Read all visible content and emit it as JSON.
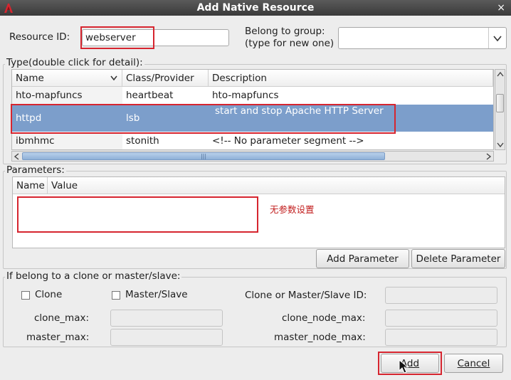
{
  "window": {
    "title": "Add Native Resource",
    "close_glyph": "×"
  },
  "resource_id": {
    "label": "Resource ID:",
    "value": "webserver"
  },
  "group": {
    "label_line1": "Belong to group:",
    "label_line2": "(type for new one)",
    "value": ""
  },
  "type_section": {
    "legend": "Type(double click for detail):",
    "columns": [
      "Name",
      "Class/Provider",
      "Description"
    ],
    "rows": [
      {
        "name": "hto-mapfuncs",
        "provider": "heartbeat",
        "description": "hto-mapfuncs"
      },
      {
        "name": "httpd",
        "provider": "lsb",
        "description": "start and stop Apache HTTP Server"
      },
      {
        "name": "ibmhmc",
        "provider": "stonith",
        "description": "<!-- No parameter segment -->"
      }
    ],
    "selected_row": 1,
    "hscroll_grip": "|||"
  },
  "parameters": {
    "legend": "Parameters:",
    "columns": [
      "Name",
      "Value"
    ],
    "note": "无参数设置",
    "add_label": "Add Parameter",
    "delete_label": "Delete Parameter"
  },
  "clone": {
    "legend": "If belong to a clone or master/slave:",
    "clone_label": "Clone",
    "master_slave_label": "Master/Slave",
    "id_label": "Clone or Master/Slave ID:",
    "clone_max_label": "clone_max:",
    "master_max_label": "master_max:",
    "clone_node_max_label": "clone_node_max:",
    "master_node_max_label": "master_node_max:"
  },
  "buttons": {
    "add": "Add",
    "cancel": "Cancel"
  },
  "colors": {
    "selection": "#7c9ecb",
    "annotation_red": "#d6252f",
    "title_bg": "#4a4a4a"
  }
}
